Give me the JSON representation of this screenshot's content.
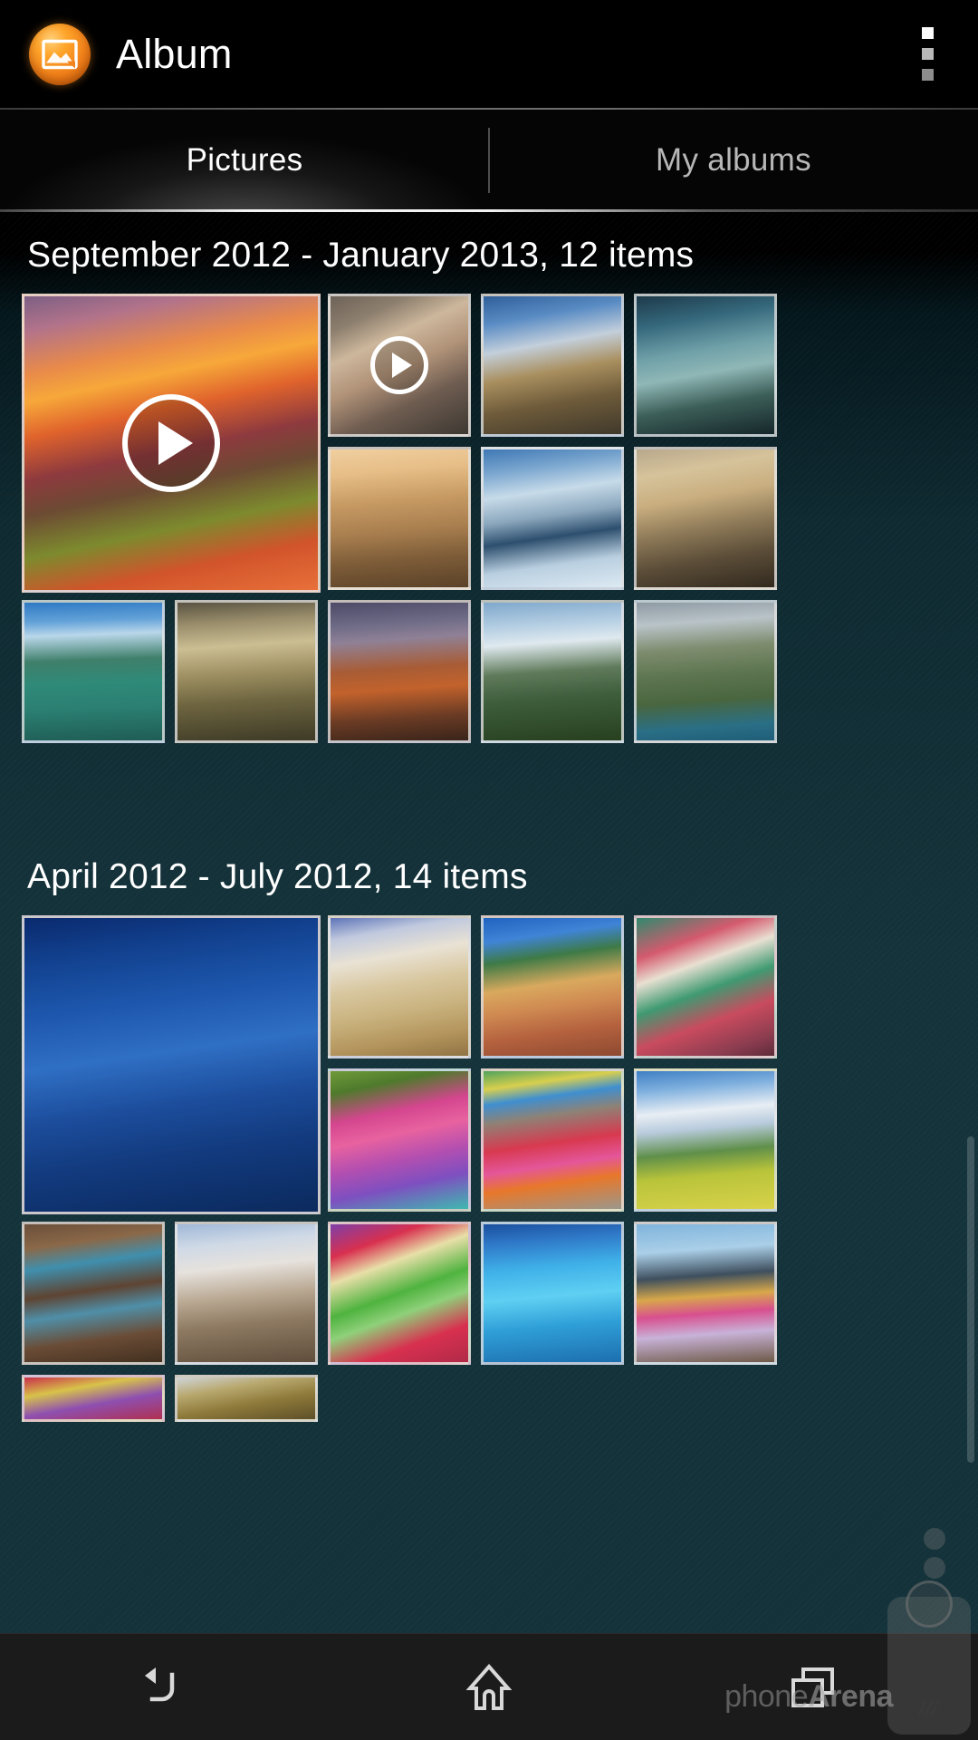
{
  "app": {
    "title": "Album",
    "icon": "photo-frame-icon"
  },
  "actionbar": {
    "overflow_label": "More options",
    "overflow_icon": "overflow-menu-icon"
  },
  "tabs": [
    {
      "label": "Pictures",
      "active": true
    },
    {
      "label": "My albums",
      "active": false
    }
  ],
  "sections": [
    {
      "title": "September 2012 - January 2013, 12 items",
      "items": [
        {
          "name": "sunset-mountains-video",
          "type": "video",
          "span": "big",
          "art": "linear-gradient(168deg,#7d5f84 0%,#b2738a 10%,#e88a4a 22%,#f7a83a 30%,#e0632c 40%,#8e3a3e 52%,#6c4a33 62%,#7d8a2e 74%,#d1542a 86%,#e8703a 100%)"
        },
        {
          "name": "man-on-couch-video",
          "type": "video",
          "span": "small",
          "art": "linear-gradient(155deg,#6d6258 0%,#8d7f6e 18%,#cdb79c 34%,#b09278 52%,#6e5c50 72%,#3d3832 100%)"
        },
        {
          "name": "cliff-clouds-photo",
          "type": "photo",
          "span": "small",
          "art": "linear-gradient(170deg,#2f5f99 0%,#5a8cc4 18%,#c3cfdb 36%,#a98f5f 54%,#6e5b3a 74%,#40392b 100%)"
        },
        {
          "name": "misty-forest-waterfall-photo",
          "type": "photo",
          "span": "small",
          "art": "linear-gradient(170deg,#1d3a4a 0%,#35687c 20%,#6fa0a8 40%,#8fb7b6 55%,#3c5e58 75%,#15262a 100%)"
        },
        {
          "name": "desert-city-photo",
          "type": "photo",
          "span": "small",
          "art": "linear-gradient(175deg,#f0cfa0 0%,#e6bd86 18%,#c79a63 38%,#a97f4f 58%,#7d5c38 78%,#5b4228 100%)"
        },
        {
          "name": "glacier-photo",
          "type": "photo",
          "span": "small",
          "art": "linear-gradient(172deg,#3f78b5 0%,#7aa6cf 16%,#c7dbe9 32%,#8ba7bd 48%,#2d4f6e 62%,#b9cfe0 80%,#dce9f2 100%)"
        },
        {
          "name": "rainbow-canyon-photo",
          "type": "photo",
          "span": "small",
          "art": "linear-gradient(170deg,#b8a88c 0%,#d6c39b 18%,#c9ae7f 36%,#8e7a58 56%,#5b4d38 76%,#32291e 100%)"
        },
        {
          "name": "halong-bay-photo",
          "type": "photo",
          "span": "small",
          "art": "linear-gradient(178deg,#2e79c4 0%,#63a2d8 14%,#b9d7ea 24%,#3f7f6a 42%,#2f8a78 58%,#2b7f72 76%,#1f5d55 100%)"
        },
        {
          "name": "dusty-valley-photo",
          "type": "photo",
          "span": "small",
          "art": "linear-gradient(176deg,#5a5342 0%,#9b8f6c 16%,#cbbe93 32%,#9f9163 50%,#6e6540 70%,#3d3a26 100%)"
        },
        {
          "name": "red-cliffs-photo",
          "type": "photo",
          "span": "small",
          "art": "linear-gradient(176deg,#4c4a66 0%,#6d6a86 16%,#8f8196 28%,#a85c35 48%,#c2622c 62%,#6a3b24 82%,#3a241a 100%)"
        },
        {
          "name": "alpine-valley-photo",
          "type": "photo",
          "span": "small",
          "art": "linear-gradient(176deg,#7fa8cc 0%,#b6cfe3 18%,#dfe9ef 30%,#5f7a5a 50%,#3e5e3c 68%,#27401f 100%)"
        },
        {
          "name": "coastal-cliff-town-photo",
          "type": "photo",
          "span": "small",
          "art": "linear-gradient(176deg,#8e9aa3 0%,#b9c3c8 16%,#7d8c6e 34%,#5d7550 52%,#49663f 70%,#2a6f86 88%,#1f5d78 100%)"
        }
      ]
    },
    {
      "title": "April 2012 - July 2012, 14 items",
      "items": [
        {
          "name": "snowy-village-night-photo",
          "type": "photo",
          "span": "big",
          "art": "linear-gradient(172deg,#0a2a6e 0%,#12418f 14%,#1d57ad 30%,#2f6fc4 46%,#1c4d9c 62%,#123a7d 78%,#0b2a5e 100%)"
        },
        {
          "name": "santorini-houses-photo",
          "type": "photo",
          "span": "small",
          "art": "linear-gradient(170deg,#5e74b8 0%,#c0c9de 14%,#e9e2d4 30%,#d8c79f 48%,#c9b27e 66%,#b3945c 84%,#8f7343 100%)"
        },
        {
          "name": "cinque-terre-photo",
          "type": "photo",
          "span": "small",
          "art": "linear-gradient(172deg,#1f63c0 0%,#3f84d6 16%,#3e7a46 30%,#d9a95e 48%,#d08b52 62%,#b4613e 80%,#8d4a31 100%)"
        },
        {
          "name": "colorful-bokeh-balls-photo",
          "type": "photo",
          "span": "small",
          "art": "linear-gradient(160deg,#2f8a6e 0%,#d45a6e 22%,#e8e0d2 36%,#3f9a72 52%,#c94b5e 70%,#8d3d50 88%,#5e2b3a 100%)"
        },
        {
          "name": "rainbow-kayaks-photo",
          "type": "photo",
          "span": "small",
          "art": "linear-gradient(168deg,#6f9b3a 0%,#4f7a2c 14%,#d4468f 32%,#e8629f 46%,#b44fb0 62%,#7e4fc0 78%,#3fb9b0 100%)"
        },
        {
          "name": "yarn-bundles-photo",
          "type": "photo",
          "span": "small",
          "art": "linear-gradient(172deg,#4fa35c 0%,#d8cf4e 12%,#3f8fd0 22%,#8e8276 34%,#d8394f 52%,#e4569a 66%,#e8772a 78%,#9b978c 100%)"
        },
        {
          "name": "cloud-over-field-photo",
          "type": "photo",
          "span": "small",
          "art": "linear-gradient(175deg,#3f7fc4 0%,#7fb0de 14%,#e8eef4 30%,#b8cbdd 42%,#5f8f4a 58%,#b9c43a 74%,#d8d24a 100%)"
        },
        {
          "name": "balcony-building-photo",
          "type": "photo",
          "span": "small",
          "art": "linear-gradient(172deg,#6b4f3a 0%,#8a6848 16%,#3f8fae 30%,#5e4432 48%,#4f8fa8 62%,#6a4c36 80%,#42301f 100%)"
        },
        {
          "name": "patagonia-peaks-photo",
          "type": "photo",
          "span": "small",
          "art": "linear-gradient(174deg,#9fb8d8 0%,#cfd9e6 16%,#e6e2dd 32%,#b9a892 52%,#8e7a62 70%,#5f4e3c 100%)"
        },
        {
          "name": "paper-flowers-photo",
          "type": "photo",
          "span": "small",
          "art": "linear-gradient(160deg,#7e3fa8 0%,#d8304f 18%,#e8dfa8 32%,#4fb33f 50%,#8fd07a 62%,#d8304f 80%,#b02a48 100%)"
        },
        {
          "name": "turquoise-reef-photo",
          "type": "photo",
          "span": "small",
          "art": "linear-gradient(175deg,#1a4f9e 0%,#2f79c8 14%,#3fb0e8 32%,#5fd0f2 52%,#2f9fd8 72%,#1d6fae 100%)"
        },
        {
          "name": "beach-huts-photo",
          "type": "photo",
          "span": "small",
          "art": "linear-gradient(176deg,#7fb4dc 0%,#aacfe8 20%,#3e4f5e 38%,#d8a84a 52%,#d84f8f 64%,#c8b2d8 78%,#6e5a48 100%)"
        },
        {
          "name": "red-fabric-photo",
          "type": "photo",
          "span": "partial",
          "art": "linear-gradient(170deg,#c8304a 0%,#d8c24a 30%,#8e4fb0 60%,#b03050 100%)"
        },
        {
          "name": "autumn-trees-photo",
          "type": "photo",
          "span": "partial",
          "art": "linear-gradient(170deg,#cfd4d8 0%,#b8a86e 30%,#8e7a3a 60%,#5e4f28 100%)"
        }
      ]
    }
  ],
  "navbar": {
    "back_label": "Back",
    "back_icon": "back-arrow-icon",
    "home_label": "Home",
    "home_icon": "home-icon",
    "recents_label": "Recent apps",
    "recents_icon": "recent-apps-icon"
  },
  "watermark": {
    "prefix": "phone",
    "suffix": "Arena",
    "slash": "///"
  },
  "colors": {
    "accent_orange": "#f2821a",
    "background_teal": "#14323a",
    "actionbar_black": "#000000",
    "active_tab_text": "#ffffff",
    "inactive_tab_text": "#b7b7b7",
    "navbar_gray": "#1b1b1b"
  }
}
